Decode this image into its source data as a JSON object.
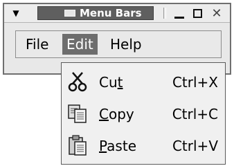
{
  "window": {
    "title": "Menu Bars"
  },
  "menubar": {
    "items": [
      {
        "label": "File"
      },
      {
        "label": "Edit"
      },
      {
        "label": "Help"
      }
    ]
  },
  "dropdown": {
    "items": [
      {
        "pre": "Cu",
        "underline": "t",
        "post": "",
        "shortcut": "Ctrl+X",
        "icon": "scissors-icon"
      },
      {
        "pre": "",
        "underline": "C",
        "post": "opy",
        "shortcut": "Ctrl+C",
        "icon": "copy-icon"
      },
      {
        "pre": "",
        "underline": "P",
        "post": "aste",
        "shortcut": "Ctrl+V",
        "icon": "paste-icon"
      }
    ]
  },
  "colors": {
    "title_bg": "#5f5f5f",
    "selected_menu_bg": "#6d6d6d",
    "menu_bg": "#f0f0f0"
  }
}
